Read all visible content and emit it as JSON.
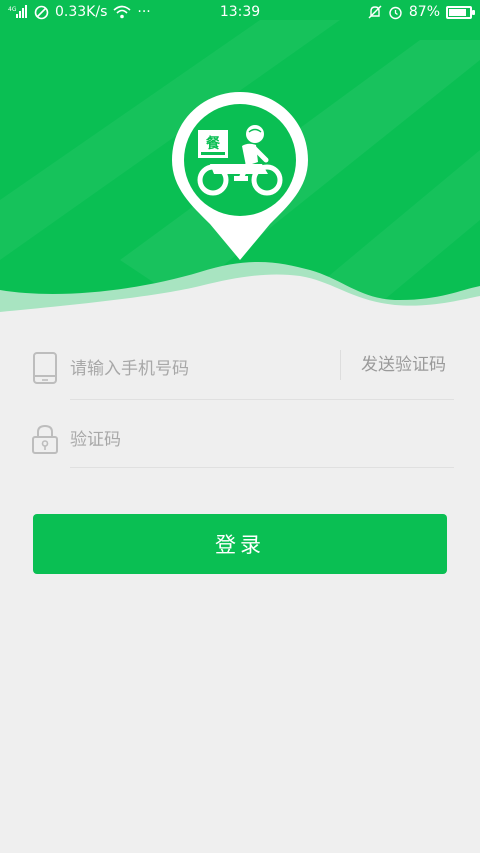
{
  "status_bar": {
    "network": "4G",
    "speed": "0.33K/s",
    "more": "···",
    "time": "13:39",
    "battery": "87%",
    "battery_level": 0.87,
    "icons": [
      "signal-icon",
      "no-disturb-icon",
      "wifi-icon",
      "bell-muted-icon",
      "alarm-icon",
      "battery-icon"
    ]
  },
  "theme": {
    "brand_green": "#0abf53",
    "header_green": "#14c05a"
  },
  "logo": {
    "badge_char": "餐",
    "icon": "delivery-rider-pin-icon"
  },
  "form": {
    "phone_placeholder": "请输入手机号码",
    "send_code_label": "发送验证码",
    "code_placeholder": "验证码",
    "login_label": "登录"
  }
}
